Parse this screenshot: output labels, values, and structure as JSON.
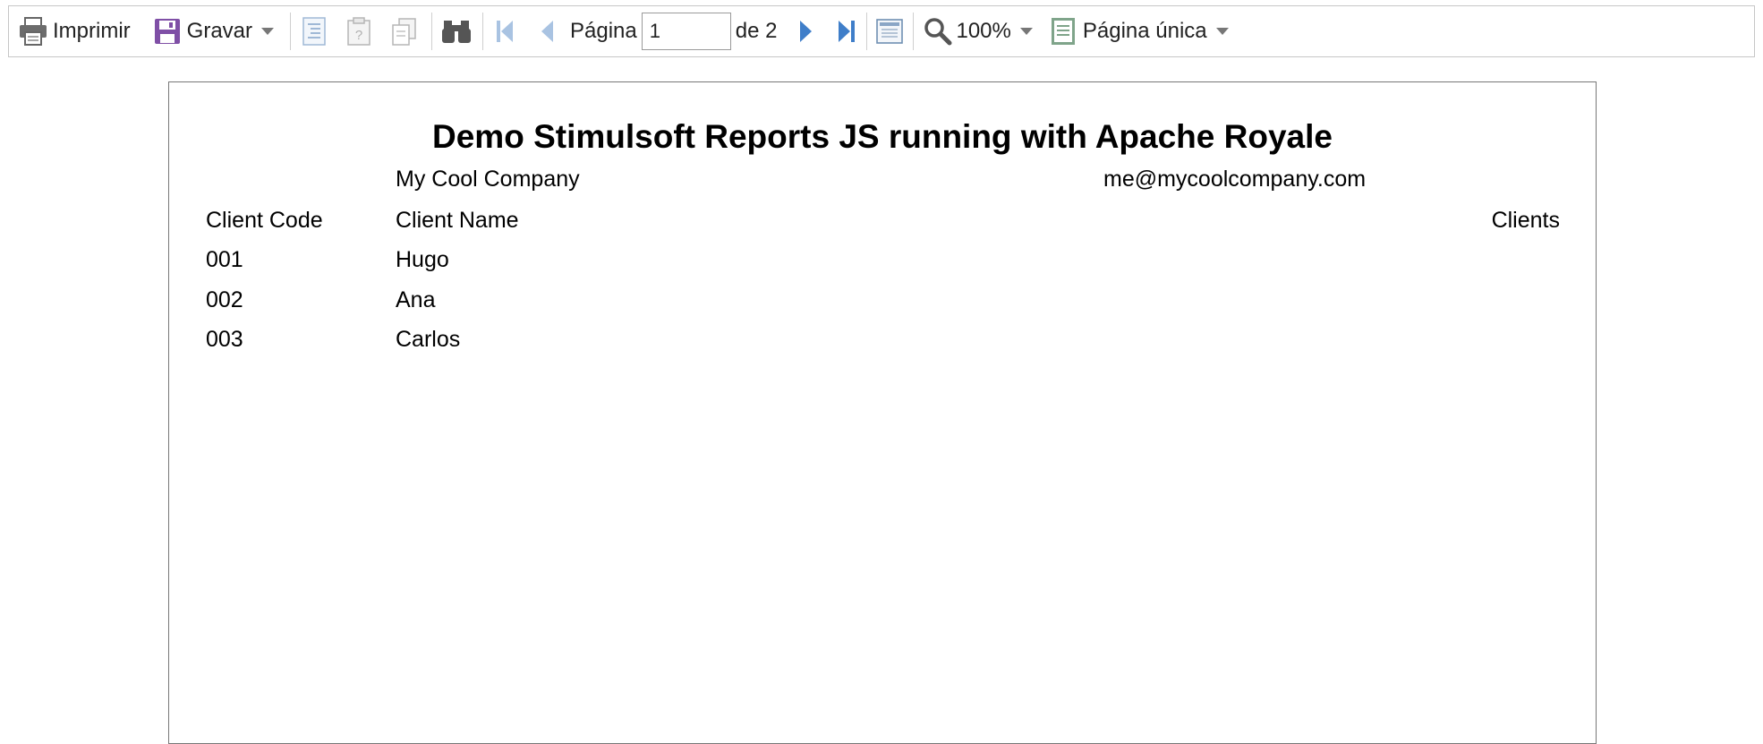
{
  "toolbar": {
    "print_label": "Imprimir",
    "save_label": "Gravar",
    "page_label": "Página",
    "page_value": "1",
    "of_label": "de 2",
    "zoom_label": "100%",
    "view_mode_label": "Página única"
  },
  "icons": {
    "print": "printer-icon",
    "save": "floppy-disk-icon",
    "bookmarks": "bookmarks-icon",
    "parameters": "parameters-icon",
    "editor": "editor-icon",
    "find": "binoculars-icon",
    "first": "first-page-icon",
    "prev": "previous-page-icon",
    "next": "next-page-icon",
    "last": "last-page-icon",
    "full_screen": "full-screen-icon",
    "zoom": "magnifier-icon",
    "view_mode": "single-page-icon"
  },
  "colors": {
    "toolbar_border": "#c6c6c6",
    "accent_blue": "#3f7ec9",
    "disabled_blue": "#a9c3e2",
    "save_purple": "#7f4fa6",
    "page_border": "#777777"
  },
  "report": {
    "title": "Demo Stimulsoft Reports JS running with Apache Royale",
    "company": "My Cool Company",
    "email": "me@mycoolcompany.com",
    "headers": {
      "code": "Client Code",
      "name": "Client Name",
      "section": "Clients"
    },
    "rows": [
      {
        "code": "001",
        "name": "Hugo"
      },
      {
        "code": "002",
        "name": "Ana"
      },
      {
        "code": "003",
        "name": "Carlos"
      }
    ]
  }
}
